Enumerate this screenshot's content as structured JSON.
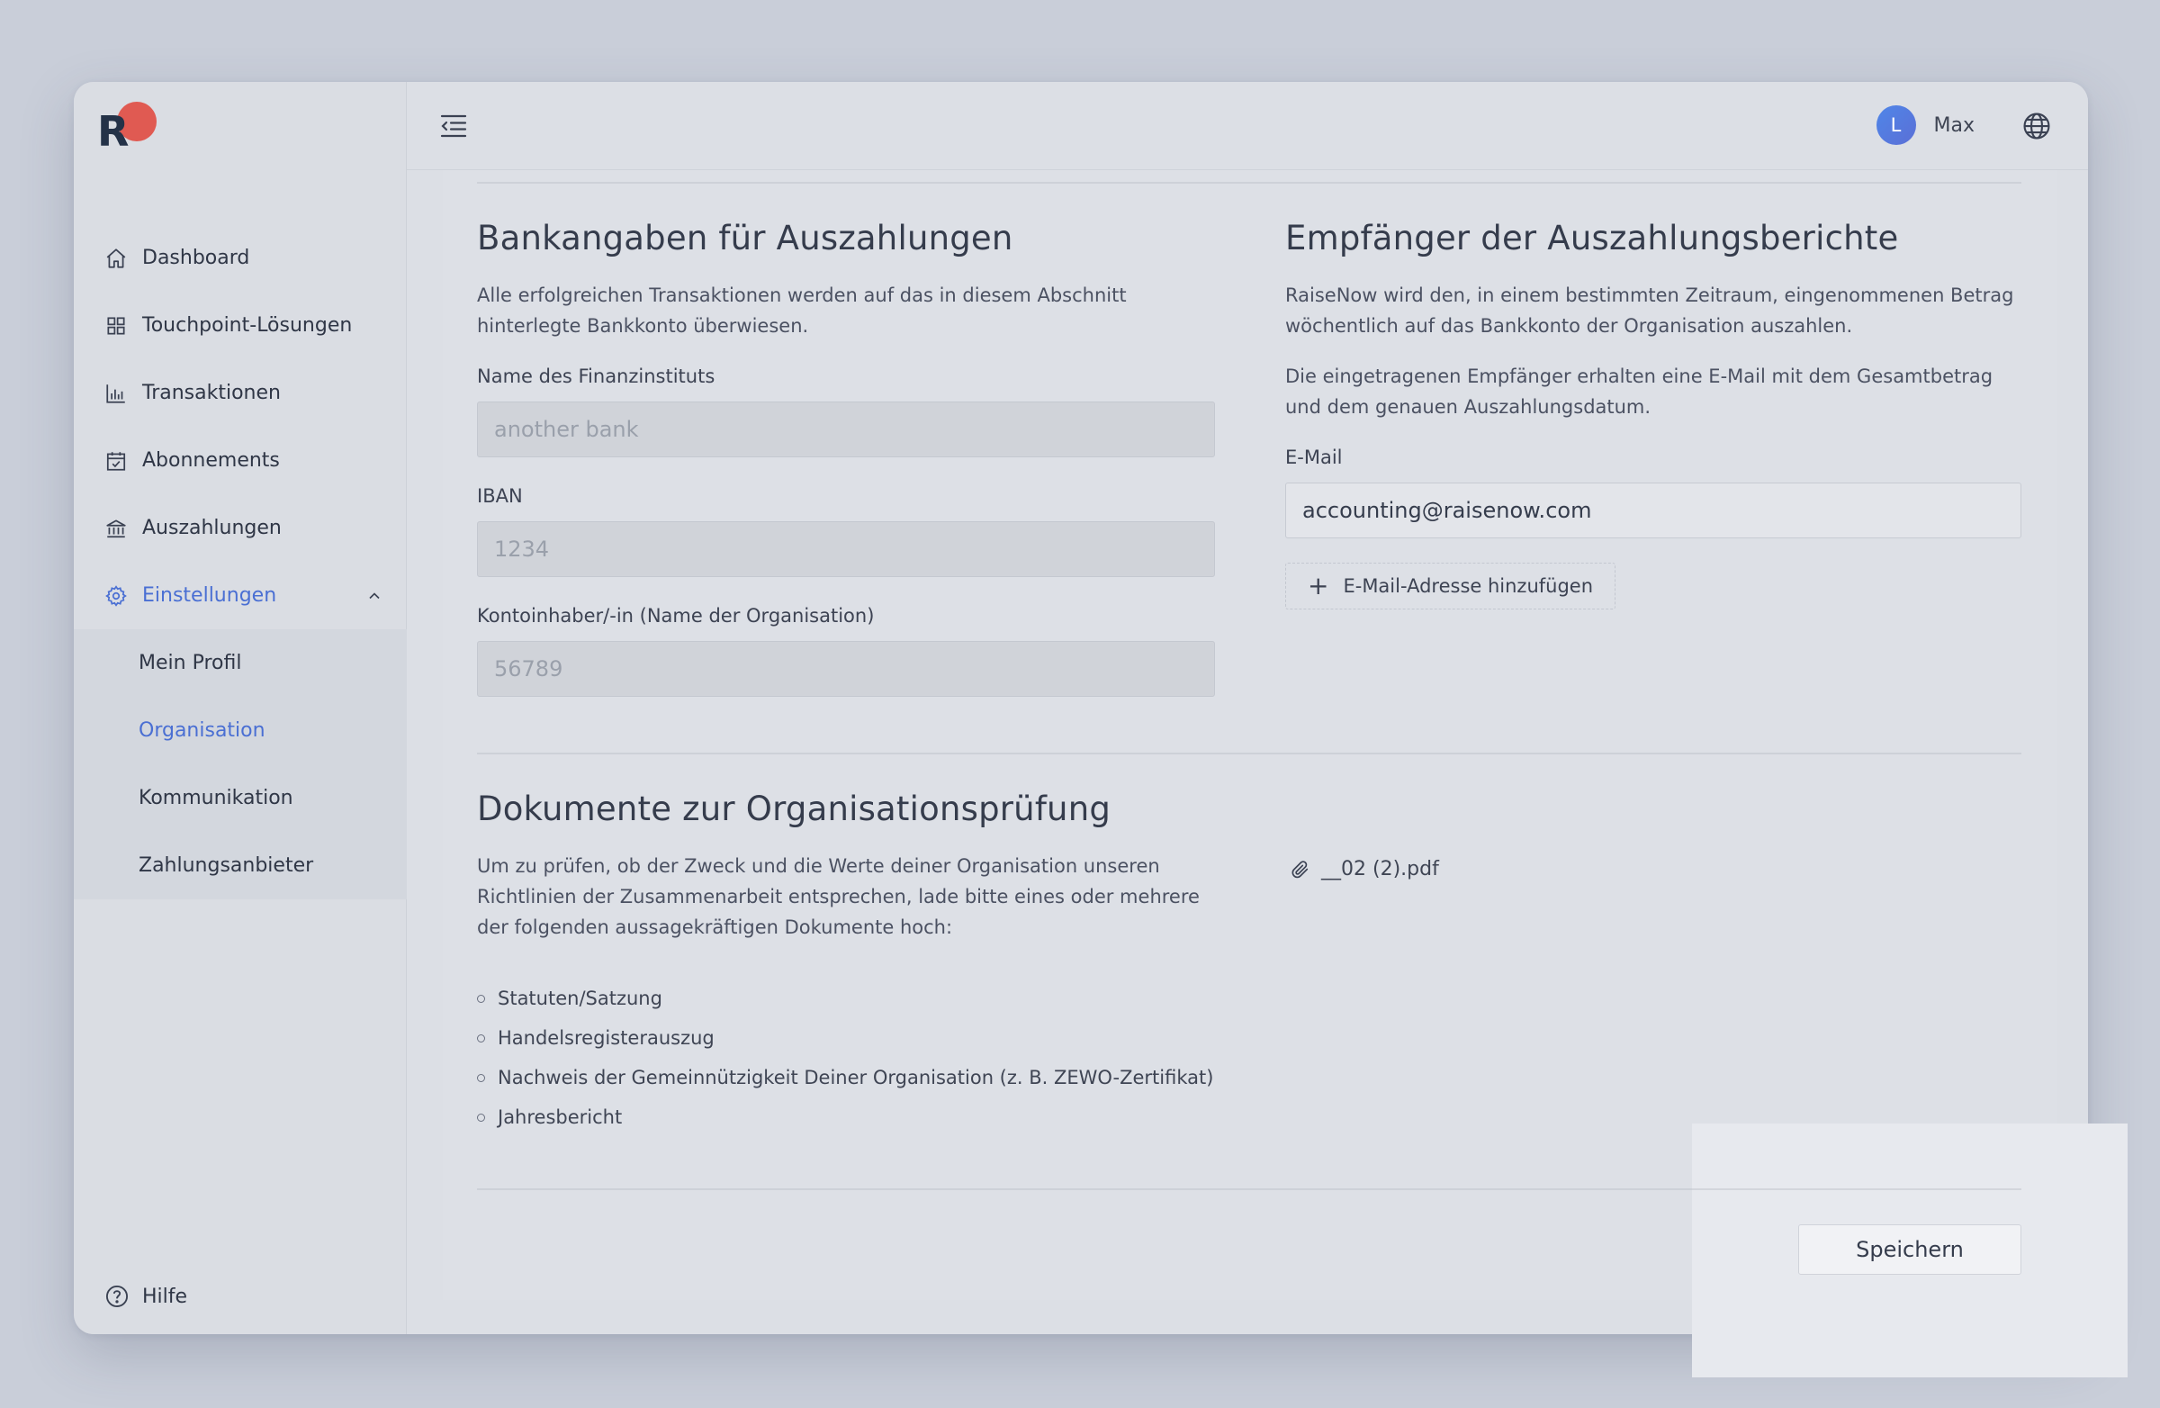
{
  "app": {
    "logo_letter": "R",
    "colors": {
      "accent": "#4a6fd3",
      "brand_dot": "#e05a52",
      "logo_text": "#243248"
    }
  },
  "sidebar": {
    "items": [
      {
        "label": "Dashboard",
        "icon": "home-icon"
      },
      {
        "label": "Touchpoint-Lösungen",
        "icon": "grid-icon"
      },
      {
        "label": "Transaktionen",
        "icon": "bar-chart-icon"
      },
      {
        "label": "Abonnements",
        "icon": "calendar-check-icon"
      },
      {
        "label": "Auszahlungen",
        "icon": "bank-icon"
      },
      {
        "label": "Einstellungen",
        "icon": "gear-icon",
        "expanded": true
      }
    ],
    "sub_items": [
      {
        "label": "Mein Profil"
      },
      {
        "label": "Organisation",
        "active": true
      },
      {
        "label": "Kommunikation"
      },
      {
        "label": "Zahlungsanbieter"
      }
    ],
    "help_label": "Hilfe"
  },
  "topbar": {
    "avatar_initial": "L",
    "user_name": "Max"
  },
  "bank": {
    "title": "Bankangaben für Auszahlungen",
    "description": "Alle erfolgreichen Transaktionen werden auf das in diesem Abschnitt hinterlegte Bankkonto überwiesen.",
    "institution_label": "Name des Finanzinstituts",
    "institution_value": "another bank",
    "iban_label": "IBAN",
    "iban_value": "1234",
    "holder_label": "Kontoinhaber/-in (Name der Organisation)",
    "holder_value": "56789"
  },
  "recipients": {
    "title": "Empfänger der Auszahlungsberichte",
    "description_1": "RaiseNow wird den, in einem bestimmten Zeitraum, eingenommenen Betrag wöchentlich auf das Bankkonto der Organisation auszahlen.",
    "description_2": "Die eingetragenen Empfänger erhalten eine E-Mail mit dem Gesamtbetrag und dem genauen Auszahlungsdatum.",
    "email_label": "E-Mail",
    "email_value": "accounting@raisenow.com",
    "add_email_label": "E-Mail-Adresse hinzufügen"
  },
  "documents": {
    "title": "Dokumente zur Organisationsprüfung",
    "description": "Um zu prüfen, ob der Zweck und die Werte deiner Organisation unseren Richtlinien der Zusammenarbeit entsprechen, lade bitte eines oder mehrere der folgenden aussagekräftigen Dokumente hoch:",
    "list": [
      "Statuten/Satzung",
      "Handelsregisterauszug",
      "Nachweis der Gemeinnützigkeit Deiner Organisation (z. B. ZEWO-Zertifikat)",
      "Jahresbericht"
    ],
    "file_name": "__02 (2).pdf"
  },
  "actions": {
    "save_label": "Speichern"
  }
}
